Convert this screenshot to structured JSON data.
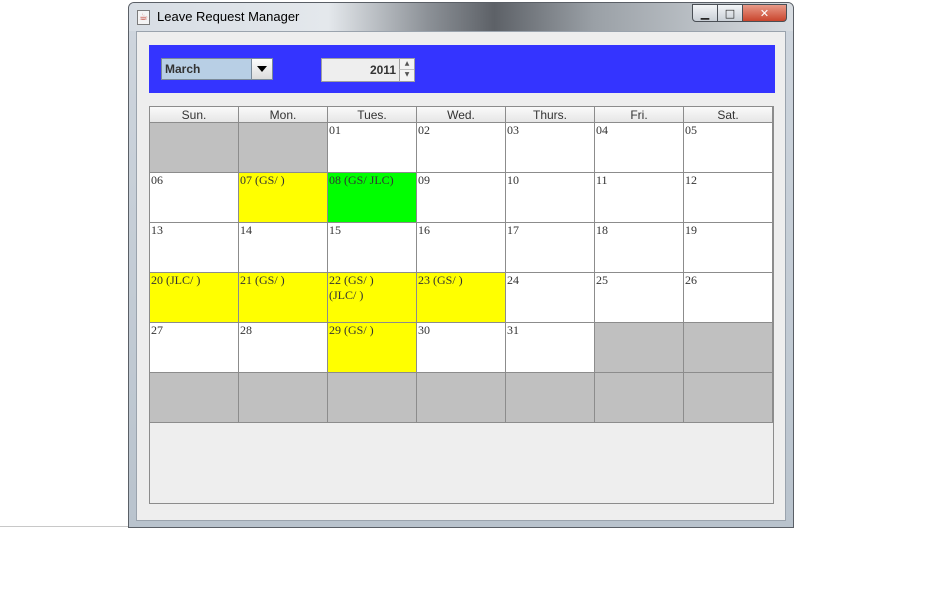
{
  "window": {
    "title": "Leave Request Manager",
    "minimize_icon": "minimize-icon",
    "maximize_icon": "maximize-icon",
    "close_icon": "close-icon"
  },
  "controls": {
    "month": "March",
    "year": "2011",
    "header_color": "#3434ff"
  },
  "calendar": {
    "day_headers": [
      "Sun.",
      "Mon.",
      "Tues.",
      "Wed.",
      "Thurs.",
      "Fri.",
      "Sat."
    ],
    "status_colors": {
      "yellow": "#ffff00",
      "green": "#00ff00",
      "empty": "#c0c0c0"
    },
    "cells": [
      {
        "text": "",
        "status": "empty"
      },
      {
        "text": "",
        "status": "empty"
      },
      {
        "text": "01",
        "status": "normal"
      },
      {
        "text": "02",
        "status": "normal"
      },
      {
        "text": "03",
        "status": "normal"
      },
      {
        "text": "04",
        "status": "normal"
      },
      {
        "text": "05",
        "status": "normal"
      },
      {
        "text": "06",
        "status": "normal"
      },
      {
        "text": "07 (GS/ )",
        "status": "yellow"
      },
      {
        "text": "08 (GS/ JLC)",
        "status": "green"
      },
      {
        "text": "09",
        "status": "normal"
      },
      {
        "text": "10",
        "status": "normal"
      },
      {
        "text": "11",
        "status": "normal"
      },
      {
        "text": "12",
        "status": "normal"
      },
      {
        "text": "13",
        "status": "normal"
      },
      {
        "text": "14",
        "status": "normal"
      },
      {
        "text": "15",
        "status": "normal"
      },
      {
        "text": "16",
        "status": "normal"
      },
      {
        "text": "17",
        "status": "normal"
      },
      {
        "text": "18",
        "status": "normal"
      },
      {
        "text": "19",
        "status": "normal"
      },
      {
        "text": "20 (JLC/ )",
        "status": "yellow"
      },
      {
        "text": "21 (GS/ )",
        "status": "yellow"
      },
      {
        "text": "22 (GS/ )\n(JLC/ )",
        "status": "yellow"
      },
      {
        "text": "23 (GS/ )",
        "status": "yellow"
      },
      {
        "text": "24",
        "status": "normal"
      },
      {
        "text": "25",
        "status": "normal"
      },
      {
        "text": "26",
        "status": "normal"
      },
      {
        "text": "27",
        "status": "normal"
      },
      {
        "text": "28",
        "status": "normal"
      },
      {
        "text": "29 (GS/ )",
        "status": "yellow"
      },
      {
        "text": "30",
        "status": "normal"
      },
      {
        "text": "31",
        "status": "normal"
      },
      {
        "text": "",
        "status": "empty"
      },
      {
        "text": "",
        "status": "empty"
      },
      {
        "text": "",
        "status": "empty"
      },
      {
        "text": "",
        "status": "empty"
      },
      {
        "text": "",
        "status": "empty"
      },
      {
        "text": "",
        "status": "empty"
      },
      {
        "text": "",
        "status": "empty"
      },
      {
        "text": "",
        "status": "empty"
      },
      {
        "text": "",
        "status": "empty"
      }
    ]
  }
}
